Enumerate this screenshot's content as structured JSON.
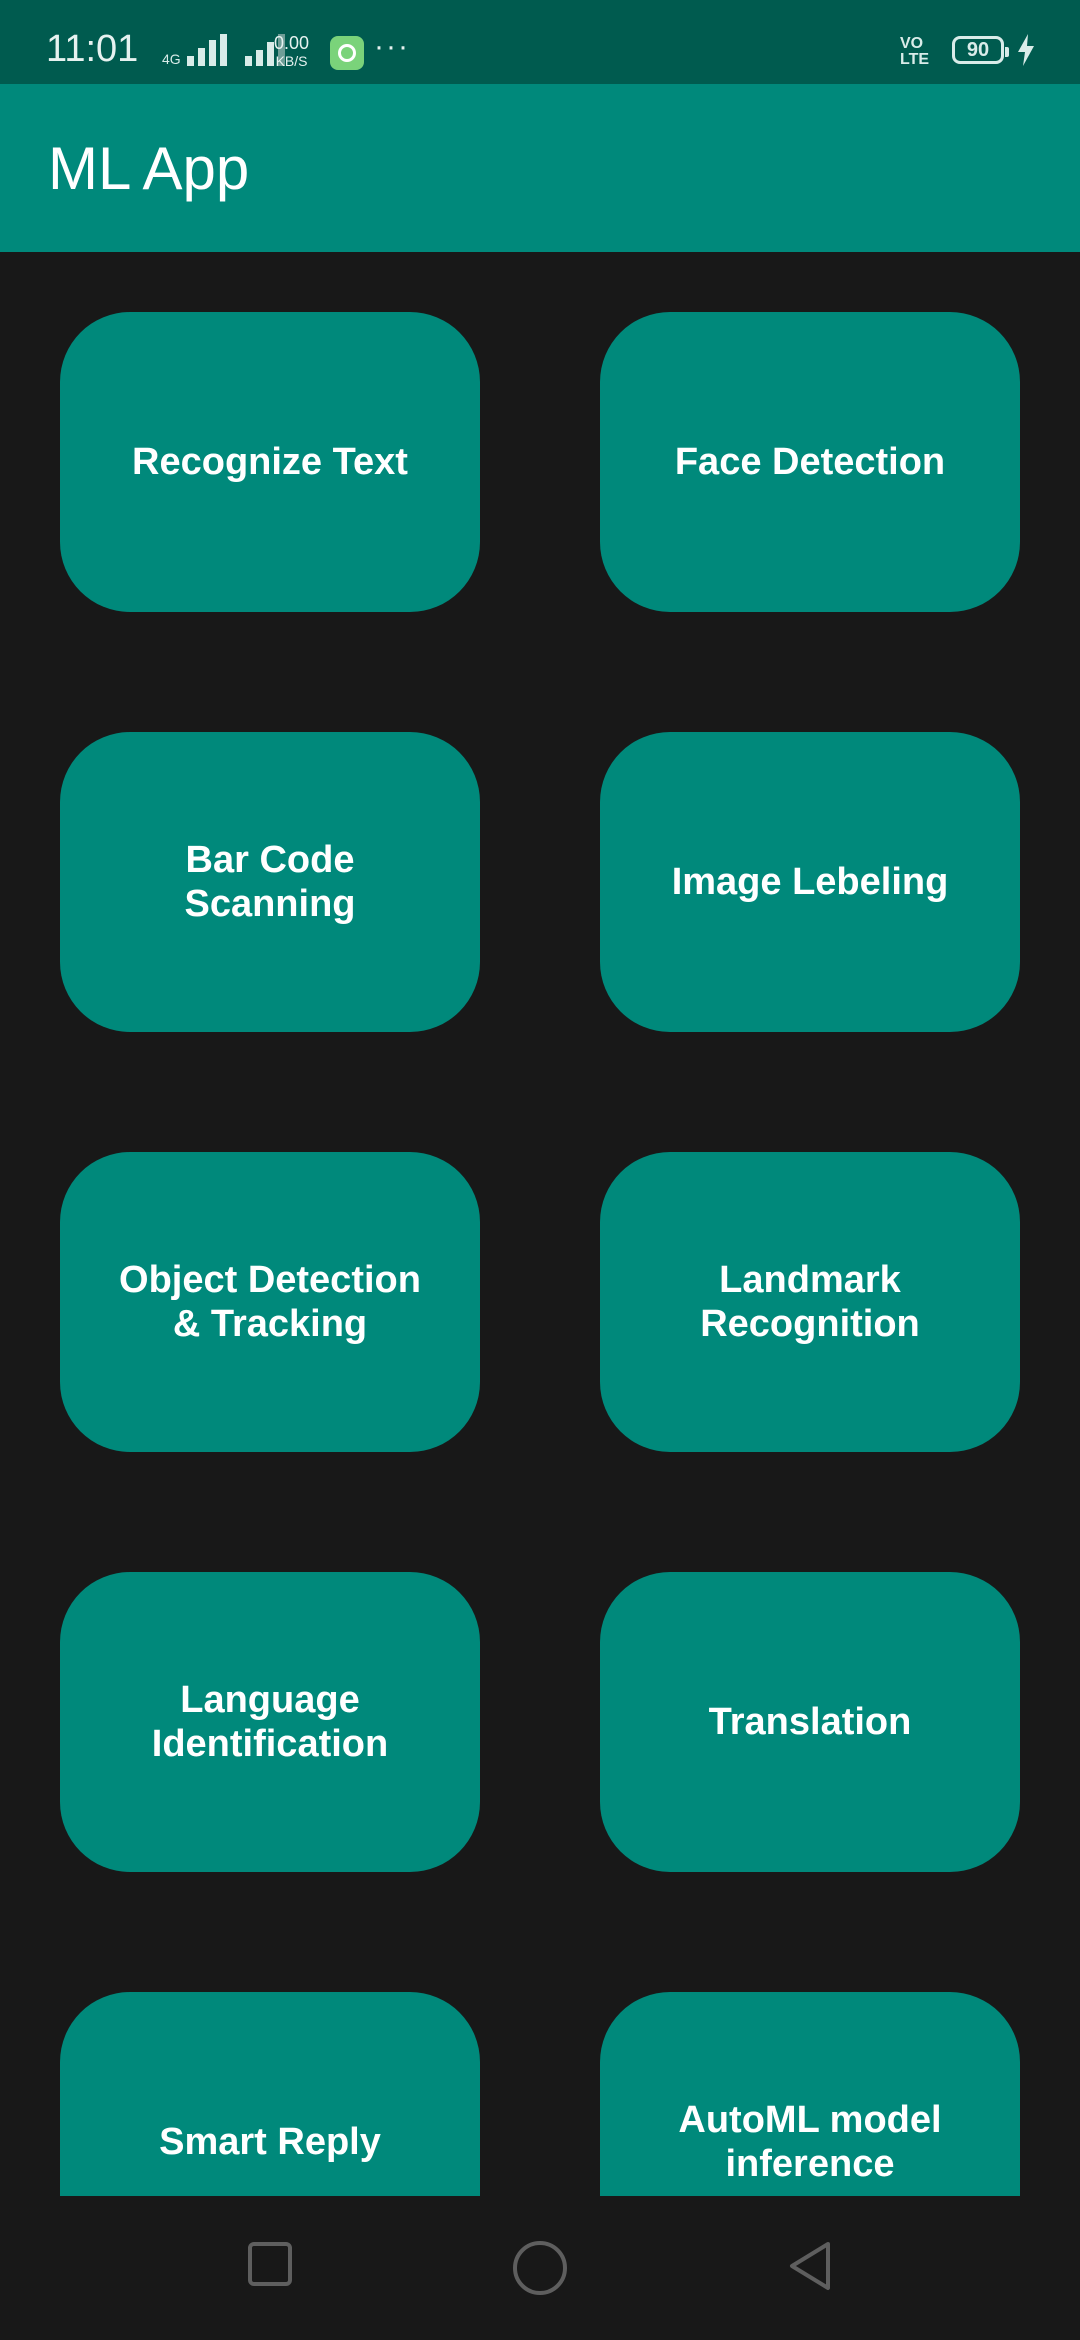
{
  "status_bar": {
    "time": "11:01",
    "network_type": "4G",
    "speed_value": "0.00",
    "speed_unit": "KB/S",
    "more": "···",
    "volte_top": "VO",
    "volte_bottom": "LTE",
    "battery_level": "90",
    "icons": [
      "signal-icon",
      "signal-icon",
      "app-notification-icon",
      "charging-icon"
    ]
  },
  "app_bar": {
    "title": "ML App"
  },
  "tiles": [
    {
      "label": "Recognize Text"
    },
    {
      "label": "Face Detection"
    },
    {
      "label": "Bar Code\nScanning"
    },
    {
      "label": "Image Lebeling"
    },
    {
      "label": "Object Detection\n& Tracking"
    },
    {
      "label": "Landmark\nRecognition"
    },
    {
      "label": "Language\nIdentification"
    },
    {
      "label": "Translation"
    },
    {
      "label": "Smart Reply"
    },
    {
      "label": "AutoML model\ninference"
    }
  ],
  "nav_bar": {
    "icons": [
      "recents-square-icon",
      "home-circle-icon",
      "back-triangle-icon"
    ]
  },
  "colors": {
    "status_bar": "#005b4f",
    "app_bar": "#00897b",
    "tile": "#00897b",
    "background": "#181818"
  }
}
